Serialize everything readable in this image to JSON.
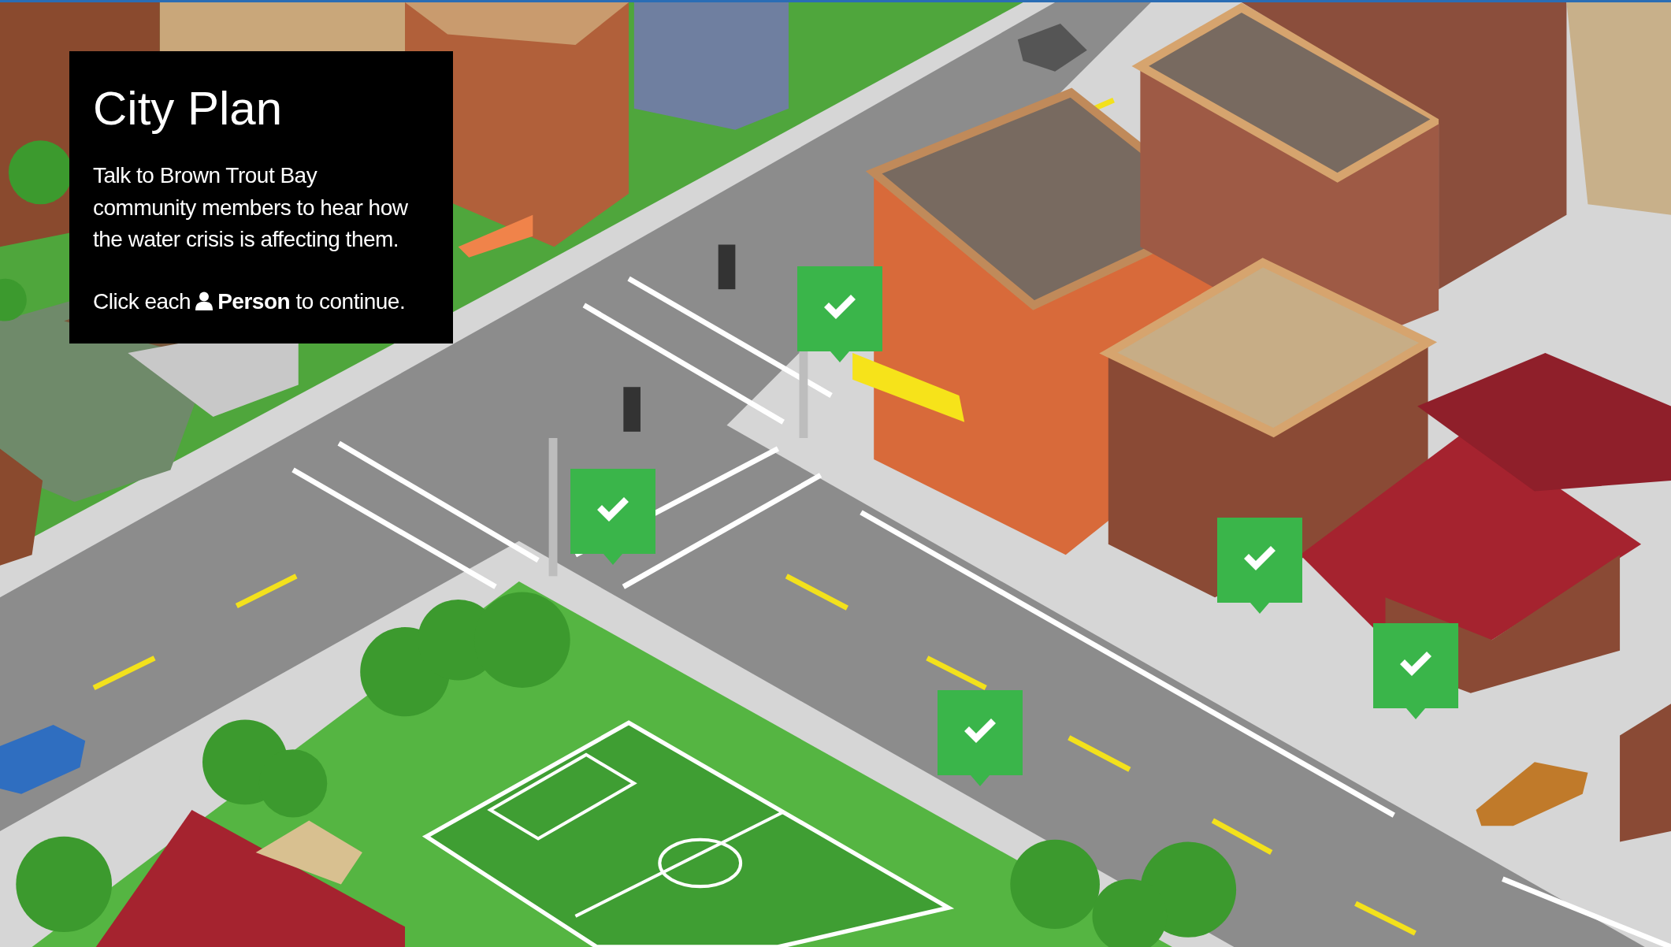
{
  "info_panel": {
    "title": "City Plan",
    "description": "Talk to Brown Trout Bay community members to hear how the water crisis is affecting them.",
    "instruction_before": "Click each",
    "instruction_after": "**Person** to continue."
  },
  "markers": [
    {
      "checked": true
    },
    {
      "checked": true
    },
    {
      "checked": true
    },
    {
      "checked": true
    },
    {
      "checked": true
    }
  ]
}
